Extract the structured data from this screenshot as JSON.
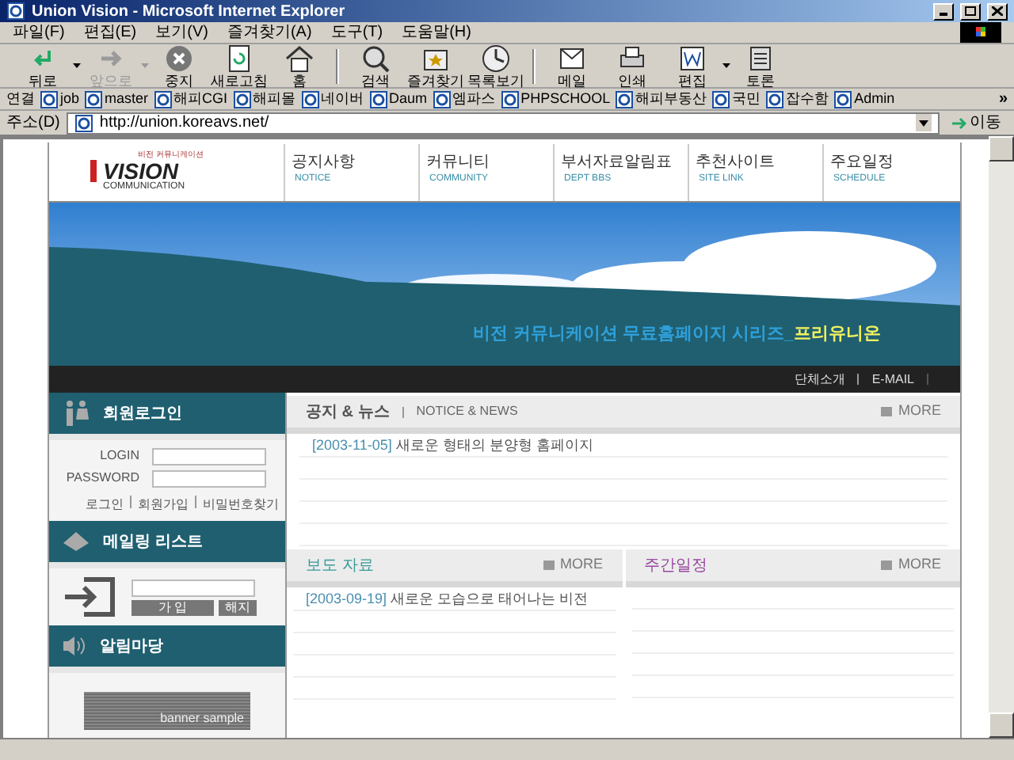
{
  "window": {
    "title": "Union Vision - Microsoft Internet Explorer"
  },
  "menu": [
    "파일(F)",
    "편집(E)",
    "보기(V)",
    "즐겨찾기(A)",
    "도구(T)",
    "도움말(H)"
  ],
  "toolbar": [
    {
      "label": "뒤로",
      "kind": "back",
      "disabled": false,
      "dropdown": true
    },
    {
      "label": "앞으로",
      "kind": "forward",
      "disabled": true,
      "dropdown": true
    },
    {
      "label": "중지",
      "kind": "stop",
      "disabled": false,
      "dropdown": false
    },
    {
      "label": "새로고침",
      "kind": "refresh",
      "disabled": false,
      "dropdown": false
    },
    {
      "label": "홈",
      "kind": "home",
      "disabled": false,
      "dropdown": false
    },
    {
      "label": "검색",
      "kind": "search",
      "disabled": false,
      "dropdown": false
    },
    {
      "label": "즐겨찾기",
      "kind": "favorites",
      "disabled": false,
      "dropdown": false
    },
    {
      "label": "목록보기",
      "kind": "history",
      "disabled": false,
      "dropdown": false
    },
    {
      "label": "메일",
      "kind": "mail",
      "disabled": false,
      "dropdown": false
    },
    {
      "label": "인쇄",
      "kind": "print",
      "disabled": false,
      "dropdown": false
    },
    {
      "label": "편집",
      "kind": "edit",
      "disabled": false,
      "dropdown": true
    },
    {
      "label": "토론",
      "kind": "discuss",
      "disabled": false,
      "dropdown": false
    }
  ],
  "links": {
    "label": "연결",
    "items": [
      "job",
      "master",
      "해피CGI",
      "해피몰",
      "네이버",
      "Daum",
      "엠파스",
      "PHPSCHOOL",
      "해피부동산",
      "국민",
      "잡수함",
      "Admin"
    ],
    "more": "»"
  },
  "address": {
    "label": "주소(D)",
    "value": "http://union.koreavs.net/",
    "go": "이동"
  },
  "site": {
    "logo": {
      "small": "비전 커뮤니케이션",
      "name": "VISION",
      "sub": "COMMUNICATION"
    },
    "nav": [
      {
        "label": "공지사항",
        "sub": "NOTICE"
      },
      {
        "label": "커뮤니티",
        "sub": "COMMUNITY"
      },
      {
        "label": "부서자료알림표",
        "sub": "DEPT BBS"
      },
      {
        "label": "추천사이트",
        "sub": "SITE LINK"
      },
      {
        "label": "주요일정",
        "sub": "SCHEDULE"
      }
    ],
    "banner": {
      "slogan": "비전 커뮤니케이션 무료홈페이지 시리즈_",
      "brand": "프리유니온"
    },
    "top_links": [
      "단체소개",
      "E-MAIL"
    ],
    "login": {
      "title": "회원로그인",
      "fields": [
        {
          "label": "LOGIN"
        },
        {
          "label": "PASSWORD"
        }
      ],
      "links": [
        "로그인",
        "회원가입",
        "비밀번호찾기"
      ]
    },
    "mailing": {
      "title": "메일링 리스트",
      "buttons": [
        "가 입",
        "해지"
      ]
    },
    "notice_board": {
      "title": "알림마당",
      "banner": "banner sample"
    },
    "news": {
      "title": "공지 & 뉴스",
      "subtitle": "NOTICE & NEWS",
      "more": "MORE",
      "rows": [
        {
          "date": "[2003-11-05]",
          "text": "새로운 형태의 분양형 홈페이지"
        }
      ]
    },
    "press": {
      "title": "보도 자료",
      "more": "MORE",
      "rows": [
        {
          "date": "[2003-09-19]",
          "text": "새로운 모습으로 태어나는 비전"
        }
      ]
    },
    "schedule": {
      "title": "주간일정",
      "more": "MORE"
    }
  }
}
